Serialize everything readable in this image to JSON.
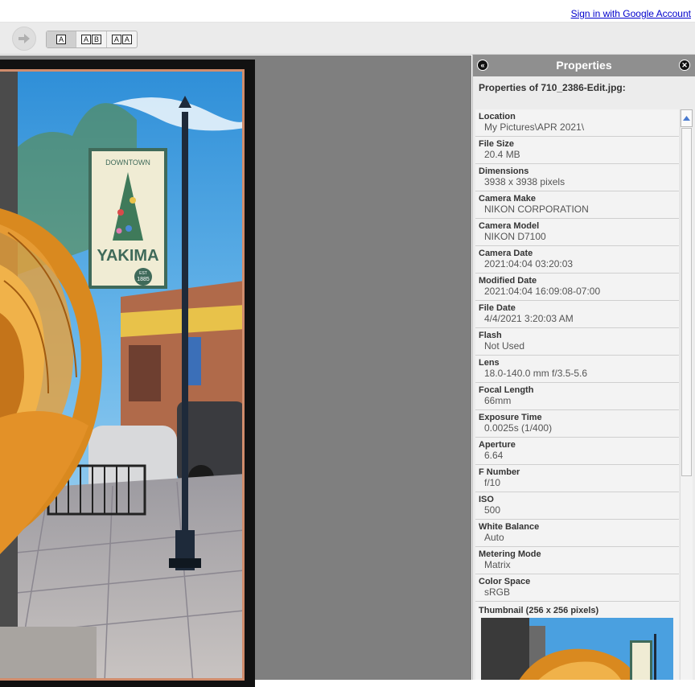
{
  "header": {
    "signin_link": "Sign in with Google Account"
  },
  "toolbar": {
    "next_icon": "arrow-right-icon",
    "view_modes": [
      {
        "boxes": [
          "A"
        ],
        "active": true
      },
      {
        "boxes": [
          "A",
          "B"
        ],
        "active": false
      },
      {
        "boxes": [
          "A",
          "A"
        ],
        "active": false
      }
    ]
  },
  "panel": {
    "title": "Properties",
    "collapse_icon": "double-chevron-left-icon",
    "close_icon": "close-circle-icon",
    "subtitle": "Properties of 710_2386-Edit.jpg:",
    "properties": [
      {
        "name": "Location",
        "value": "My Pictures\\APR 2021\\"
      },
      {
        "name": "File Size",
        "value": "20.4 MB"
      },
      {
        "name": "Dimensions",
        "value": "3938 x 3938 pixels"
      },
      {
        "name": "Camera Make",
        "value": "NIKON CORPORATION"
      },
      {
        "name": "Camera Model",
        "value": "NIKON D7100"
      },
      {
        "name": "Camera Date",
        "value": "2021:04:04 03:20:03"
      },
      {
        "name": "Modified Date",
        "value": "2021:04:04 16:09:08-07:00"
      },
      {
        "name": "File Date",
        "value": "4/4/2021 3:20:03 AM"
      },
      {
        "name": "Flash",
        "value": "Not Used"
      },
      {
        "name": "Lens",
        "value": "18.0-140.0 mm f/3.5-5.6"
      },
      {
        "name": "Focal Length",
        "value": "66mm"
      },
      {
        "name": "Exposure Time",
        "value": "0.0025s (1/400)"
      },
      {
        "name": "Aperture",
        "value": "6.64"
      },
      {
        "name": "F Number",
        "value": "f/10"
      },
      {
        "name": "ISO",
        "value": "500"
      },
      {
        "name": "White Balance",
        "value": "Auto"
      },
      {
        "name": "Metering Mode",
        "value": "Matrix"
      },
      {
        "name": "Color Space",
        "value": "sRGB"
      }
    ],
    "thumbnail_label": "Thumbnail (256 x 256 pixels)"
  },
  "photo": {
    "banner_top": "DOWNTOWN",
    "banner_city": "YAKIMA",
    "banner_est": "EST",
    "banner_year": "1885",
    "frame_color": "#d08c6c"
  }
}
